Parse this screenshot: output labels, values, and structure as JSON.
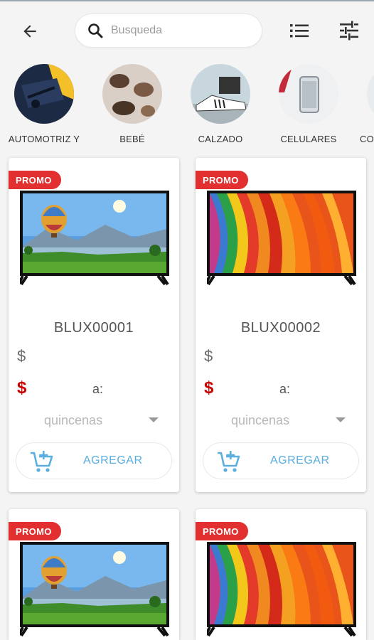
{
  "header": {
    "search_placeholder": "Busqueda",
    "back_icon": "arrow-left-icon",
    "list_icon": "list-view-icon",
    "filter_icon": "sliders-filter-icon"
  },
  "categories": [
    {
      "label": "AUTOMOTRIZ Y"
    },
    {
      "label": "BEBÉ"
    },
    {
      "label": "CALZADO"
    },
    {
      "label": "CELULARES"
    },
    {
      "label": "CO"
    }
  ],
  "products": [
    {
      "badge": "PROMO",
      "code": "BLUX00001",
      "price_symbol": "$",
      "sale_symbol": "$",
      "a_label": "a:",
      "installments": "quincenas",
      "add_label": "AGREGAR",
      "image": "tv-landscape-balloon"
    },
    {
      "badge": "PROMO",
      "code": "BLUX00002",
      "price_symbol": "$",
      "sale_symbol": "$",
      "a_label": "a:",
      "installments": "quincenas",
      "add_label": "AGREGAR",
      "image": "tv-colorful-abstract"
    },
    {
      "badge": "PROMO",
      "image": "tv-landscape-balloon"
    },
    {
      "badge": "PROMO",
      "image": "tv-colorful-abstract"
    }
  ],
  "colors": {
    "promo": "#e23030",
    "sale_price": "#c80000",
    "accent": "#5aaee0"
  }
}
